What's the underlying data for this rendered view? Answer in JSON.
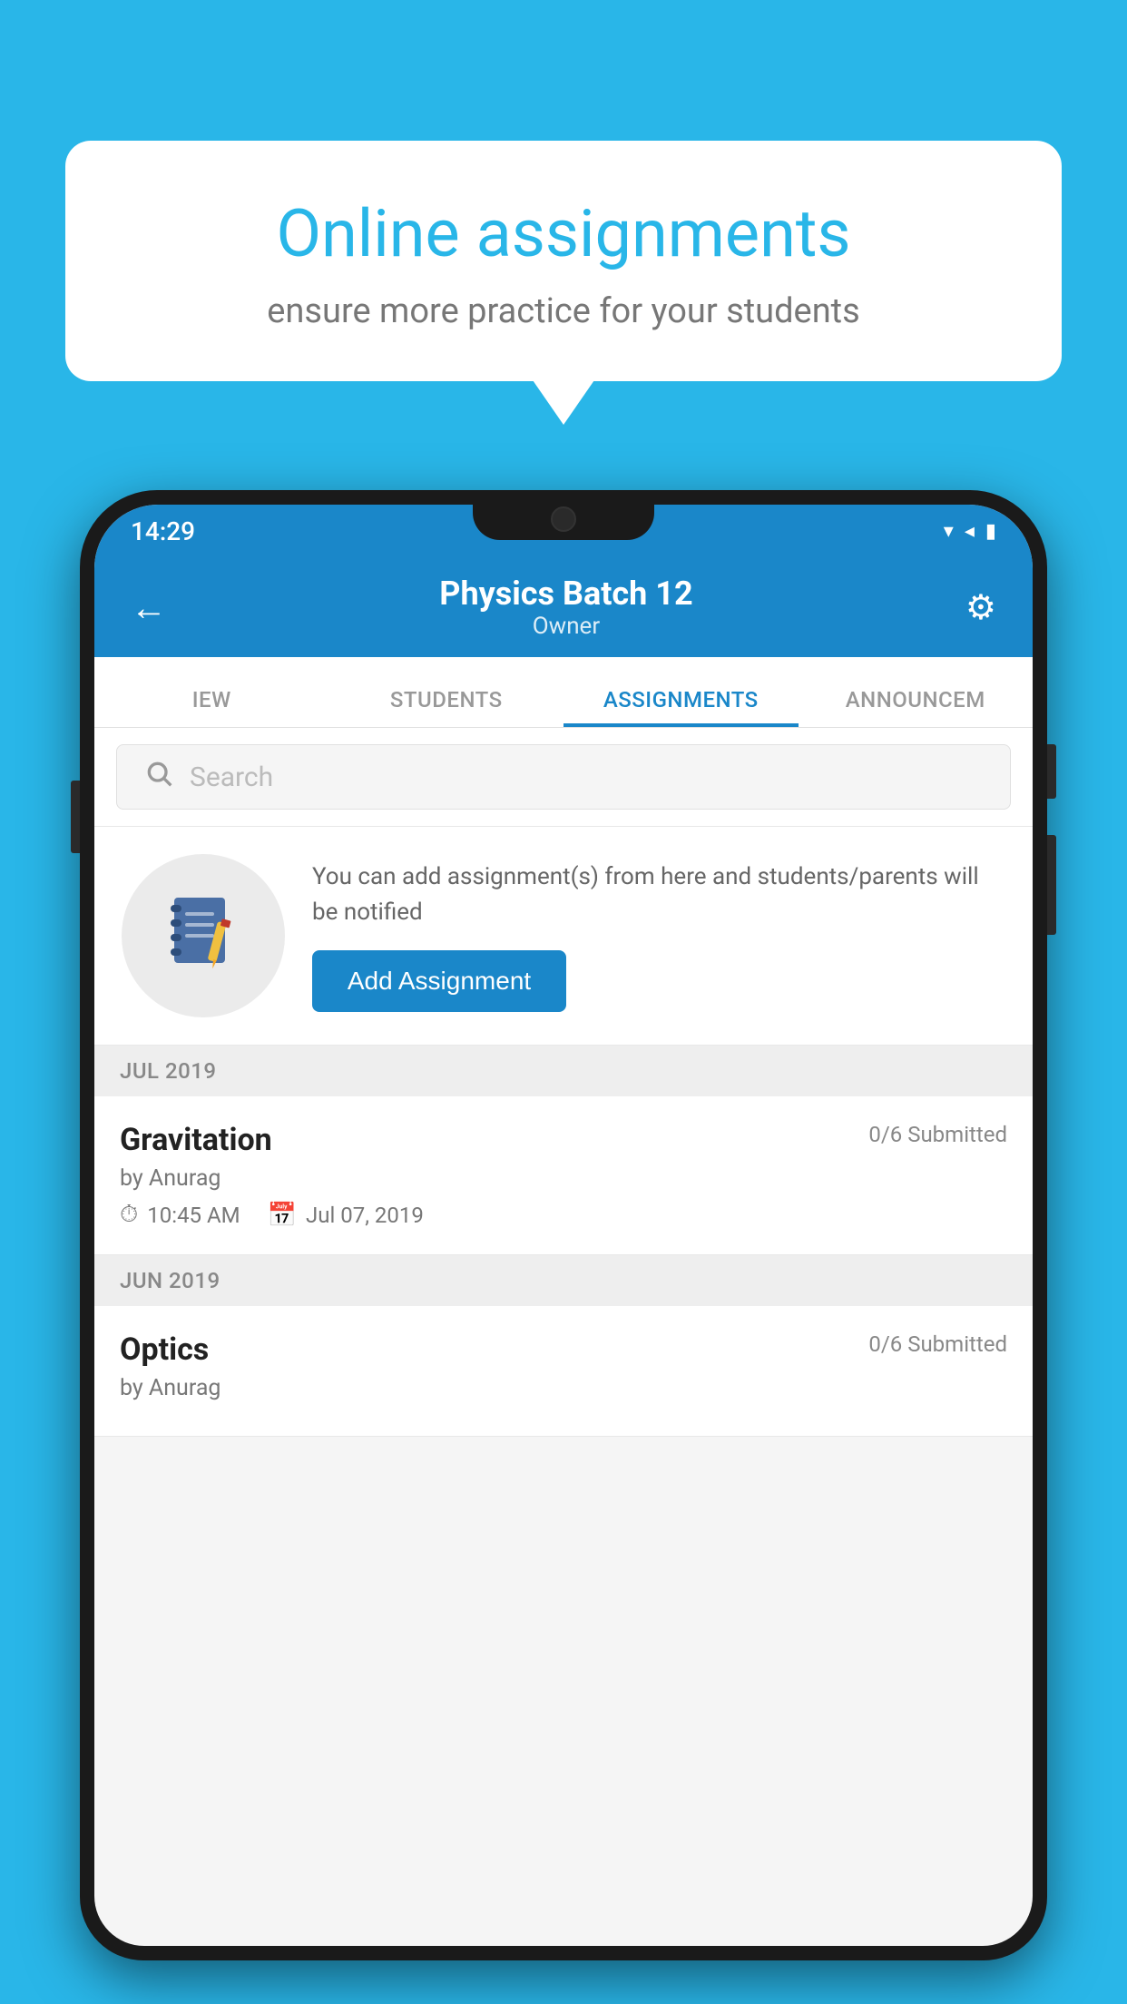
{
  "background_color": "#29b6e8",
  "speech_bubble": {
    "title": "Online assignments",
    "subtitle": "ensure more practice for your students"
  },
  "phone": {
    "status_bar": {
      "time": "14:29",
      "wifi": "▾",
      "signal": "▲",
      "battery": "▮"
    },
    "header": {
      "title": "Physics Batch 12",
      "subtitle": "Owner",
      "back_label": "←",
      "settings_label": "⚙"
    },
    "tabs": [
      {
        "label": "IEW",
        "active": false
      },
      {
        "label": "STUDENTS",
        "active": false
      },
      {
        "label": "ASSIGNMENTS",
        "active": true
      },
      {
        "label": "ANNOUNCEM",
        "active": false
      }
    ],
    "search": {
      "placeholder": "Search"
    },
    "promo": {
      "description": "You can add assignment(s) from here and students/parents will be notified",
      "button_label": "Add Assignment"
    },
    "sections": [
      {
        "month": "JUL 2019",
        "assignments": [
          {
            "title": "Gravitation",
            "submitted": "0/6 Submitted",
            "by": "by Anurag",
            "time": "10:45 AM",
            "date": "Jul 07, 2019"
          }
        ]
      },
      {
        "month": "JUN 2019",
        "assignments": [
          {
            "title": "Optics",
            "submitted": "0/6 Submitted",
            "by": "by Anurag",
            "time": "",
            "date": ""
          }
        ]
      }
    ]
  }
}
